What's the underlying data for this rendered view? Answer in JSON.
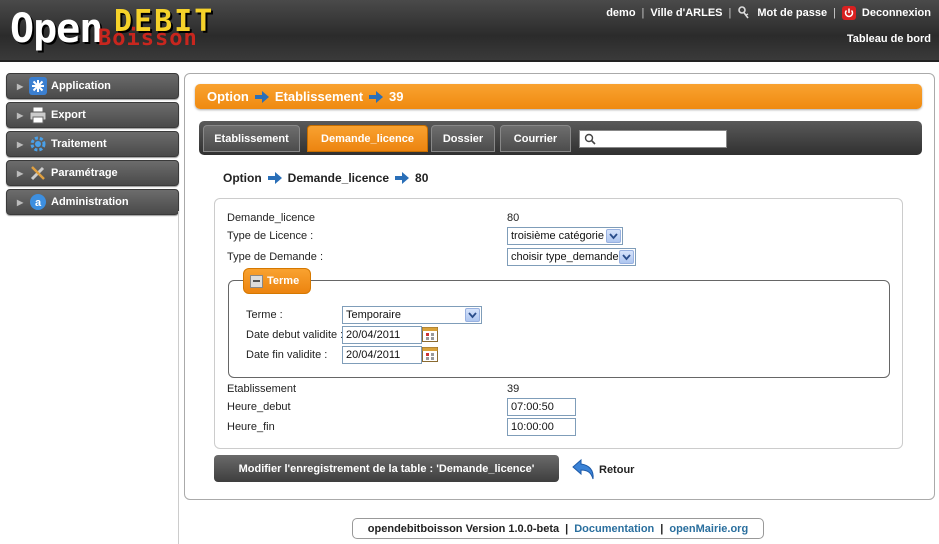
{
  "header": {
    "logo_open": "Open",
    "logo_debit": "DEBIT",
    "logo_boisson": "Boisson",
    "user": "demo",
    "city": "Ville d'ARLES",
    "password_link": "Mot de passe",
    "logout_link": "Deconnexion",
    "dashboard_link": "Tableau de bord"
  },
  "sidebar": {
    "items": [
      {
        "label": "Application",
        "icon": "asterisk-icon"
      },
      {
        "label": "Export",
        "icon": "printer-icon"
      },
      {
        "label": "Traitement",
        "icon": "gear-icon"
      },
      {
        "label": "Paramétrage",
        "icon": "tools-icon"
      },
      {
        "label": "Administration",
        "icon": "admin-icon"
      }
    ]
  },
  "breadcrumb": {
    "parts": [
      "Option",
      "Etablissement",
      "39"
    ]
  },
  "tabs": [
    {
      "label": "Etablissement",
      "active": false
    },
    {
      "label": "Demande_licence",
      "active": true
    },
    {
      "label": "Dossier",
      "active": false
    },
    {
      "label": "Courrier",
      "active": false
    }
  ],
  "search": {
    "value": ""
  },
  "sub_crumb": {
    "parts": [
      "Option",
      "Demande_licence",
      "80"
    ]
  },
  "form": {
    "demande_licence_label": "Demande_licence",
    "demande_licence_value": "80",
    "type_licence_label": "Type de Licence :",
    "type_licence_value": "troisième catégorie",
    "type_demande_label": "Type de Demande :",
    "type_demande_value": "choisir type_demande",
    "fieldset_title": "Terme",
    "terme_label": "Terme :",
    "terme_value": "Temporaire",
    "date_debut_label": "Date debut validite :",
    "date_debut_value": "20/04/2011",
    "date_fin_label": "Date fin validite :",
    "date_fin_value": "20/04/2011",
    "etablissement_label": "Etablissement",
    "etablissement_value": "39",
    "heure_debut_label": "Heure_debut",
    "heure_debut_value": "07:00:50",
    "heure_fin_label": "Heure_fin",
    "heure_fin_value": "10:00:00"
  },
  "actions": {
    "submit_label": "Modifier l'enregistrement de la table : 'Demande_licence'",
    "back_label": "Retour"
  },
  "footer": {
    "version": "opendebitboisson Version 1.0.0-beta",
    "documentation": "Documentation",
    "openmairie": "openMairie.org"
  },
  "colors": {
    "accent_orange": "#f39415",
    "header_dark": "#333333",
    "link_blue": "#2a6f9e"
  }
}
